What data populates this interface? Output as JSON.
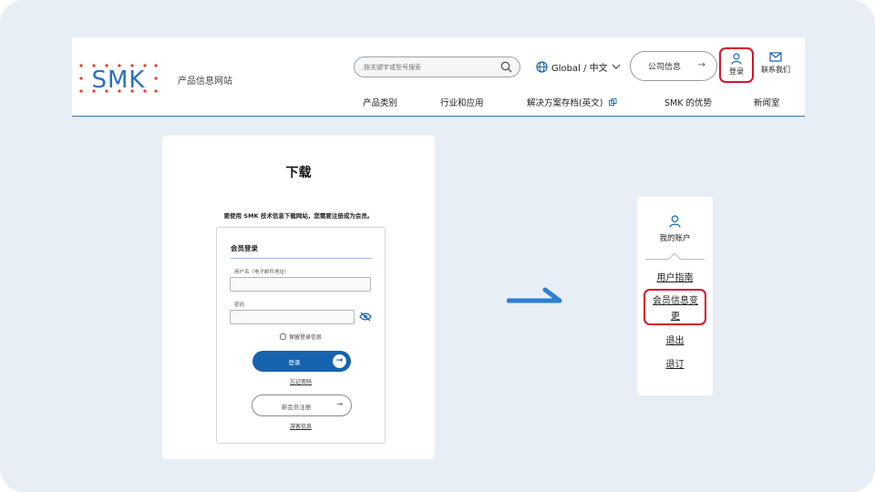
{
  "header": {
    "logo_text": "SMK",
    "site_name": "产品信息网站",
    "search": {
      "placeholder": "按关键字或型号搜索",
      "icon": "search-icon"
    },
    "language": "Global / 中文",
    "company_info": "公司信息",
    "login": "登录",
    "contact": "联系我们",
    "nav": [
      "产品类别",
      "行业和应用",
      "解决方案存档(英文)",
      "SMK 的优势",
      "新闻室"
    ],
    "colors": {
      "brand_blue": "#1663b0",
      "header_rule": "#3b6fb3",
      "highlight_red": "#d7142b"
    }
  },
  "download_card": {
    "title": "下载",
    "notice": "要使用 SMK 技术信息下载网站，您需要注册成为会员。",
    "login_box": {
      "heading": "会员登录",
      "username_label": "用户名（电子邮件地址）",
      "password_label": "密码",
      "keep_login": "保留登录信息",
      "submit": "登录",
      "forgot_password": "忘记密码",
      "register": "新会员注册",
      "guest_info": "游客信息"
    }
  },
  "account_menu": {
    "title": "我的账户",
    "items": [
      "用户指南",
      "会员信息变更",
      "退出",
      "退订"
    ],
    "change_line1": "会员信息变",
    "change_line2": "更"
  }
}
